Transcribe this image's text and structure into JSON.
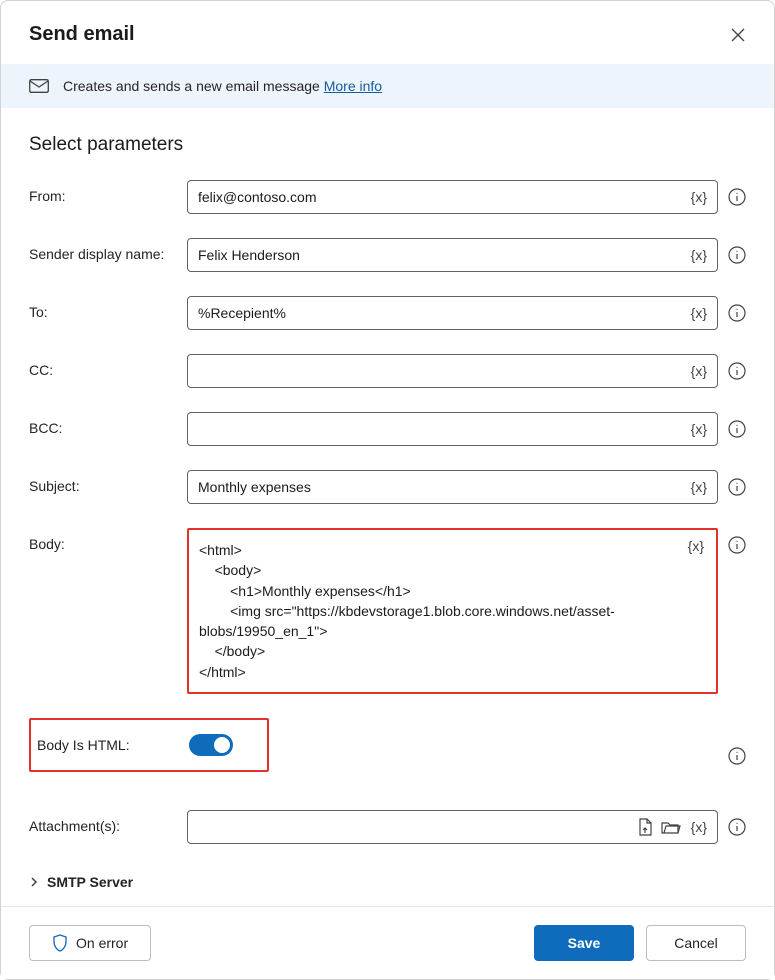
{
  "dialog": {
    "title": "Send email",
    "banner_text": "Creates and sends a new email message ",
    "more_info": "More info"
  },
  "section": {
    "title": "Select parameters"
  },
  "fields": {
    "from": {
      "label": "From:",
      "value": "felix@contoso.com"
    },
    "senderDisplay": {
      "label": "Sender display name:",
      "value": "Felix Henderson"
    },
    "to": {
      "label": "To:",
      "value": "%Recepient%"
    },
    "cc": {
      "label": "CC:",
      "value": ""
    },
    "bcc": {
      "label": "BCC:",
      "value": ""
    },
    "subject": {
      "label": "Subject:",
      "value": "Monthly expenses"
    },
    "body": {
      "label": "Body:",
      "value": "<html>\n    <body>\n        <h1>Monthly expenses</h1>\n        <img src=\"https://kbdevstorage1.blob.core.windows.net/asset-blobs/19950_en_1\">\n    </body>\n</html>"
    },
    "bodyIsHtml": {
      "label": "Body Is HTML:",
      "value": true
    },
    "attachments": {
      "label": "Attachment(s):",
      "value": ""
    }
  },
  "varToken": "{x}",
  "collapsible": {
    "smtp": "SMTP Server"
  },
  "footer": {
    "onError": "On error",
    "save": "Save",
    "cancel": "Cancel"
  }
}
